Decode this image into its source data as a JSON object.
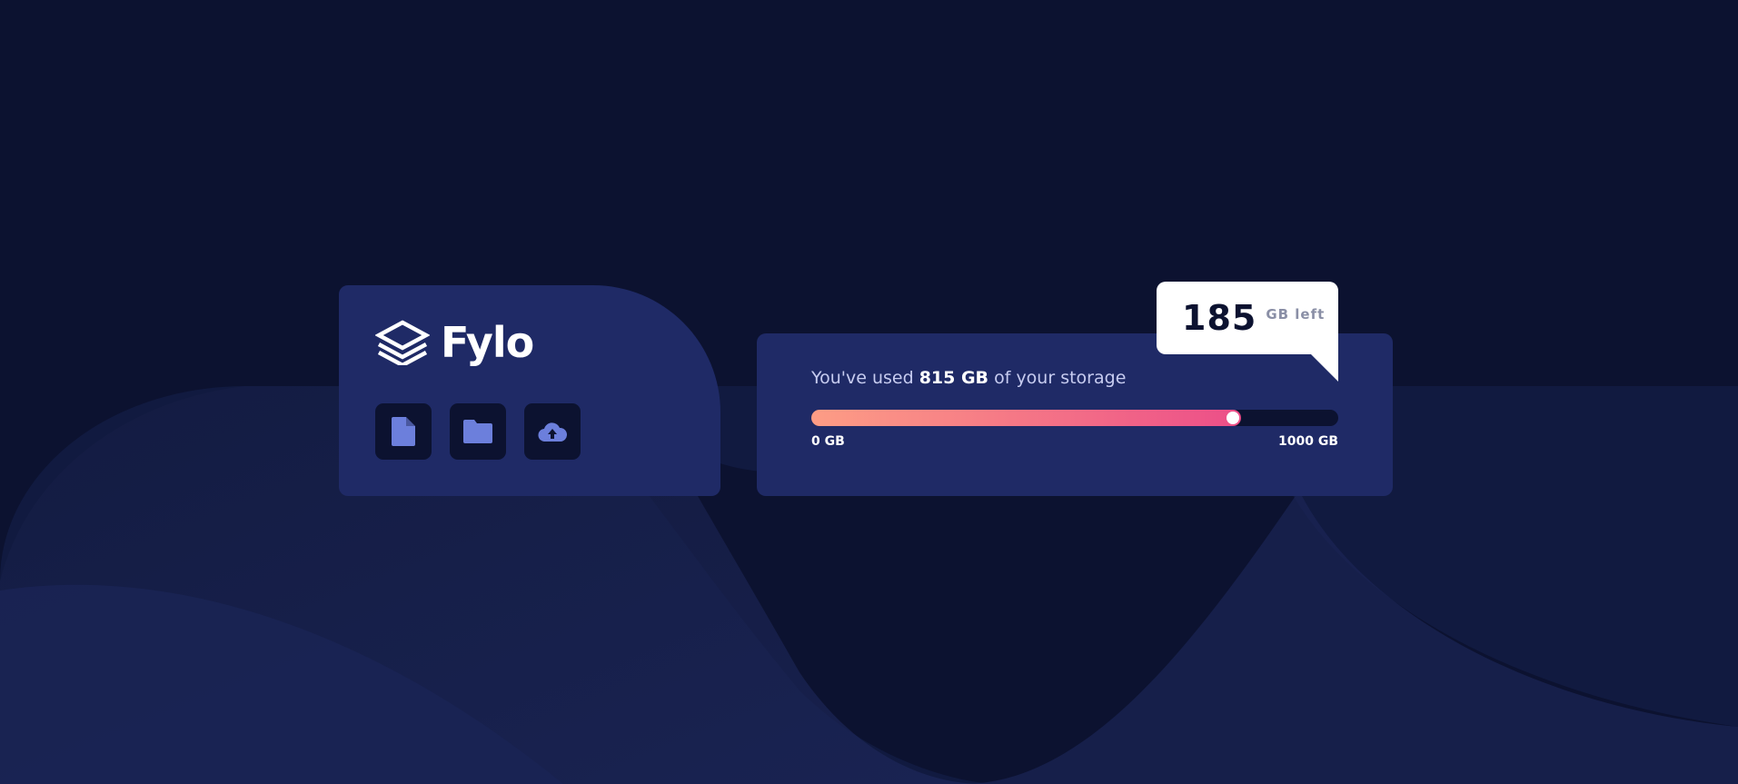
{
  "brand": {
    "name": "Fylo",
    "logo_icon": "layers-icon"
  },
  "actions": [
    {
      "icon": "document-icon"
    },
    {
      "icon": "folder-icon"
    },
    {
      "icon": "cloud-upload-icon"
    }
  ],
  "storage": {
    "prefix": "You've used ",
    "used": "815 GB",
    "suffix": " of your storage",
    "min_label": "0 GB",
    "max_label": "1000 GB",
    "used_fraction": 0.815,
    "remaining_value": "185",
    "remaining_unit": "GB left"
  },
  "colors": {
    "background": "#0c1230",
    "card": "#1f2a66",
    "accent_icon": "#6c7fdc",
    "gradient_start": "#fd9d85",
    "gradient_end": "#ec4e88"
  }
}
